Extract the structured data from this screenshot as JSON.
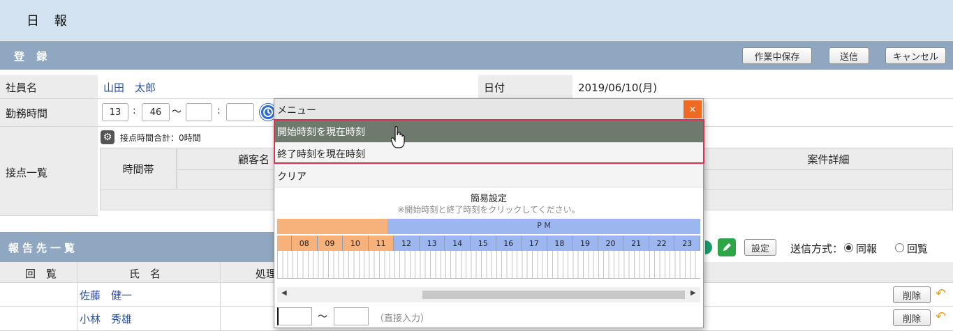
{
  "page": {
    "title": "日 報"
  },
  "register": {
    "title": "登 録",
    "buttons": {
      "save_work": "作業中保存",
      "send": "送信",
      "cancel": "キャンセル"
    },
    "employee_label": "社員名",
    "employee_name": "山田　太郎",
    "date_label": "日付",
    "date_value": "2019/06/10(月)",
    "work_time_label": "勤務時間",
    "start_hour": "13",
    "start_minute": "46",
    "colon": ":",
    "tilde": "〜",
    "contact_list_label": "接点一覧",
    "contact_total": "接点時間合計：0時間",
    "columns": {
      "time_slot": "時間帯",
      "customer_name": "顧客名",
      "case_detail": "案件詳細"
    }
  },
  "report": {
    "title": "報告先一覧",
    "settings_button": "設定",
    "send_method_label": "送信方式：",
    "send_method_options": [
      "同報",
      "回覧"
    ],
    "columns": {
      "circulation": "回　覧",
      "name": "氏　名",
      "process": "処理"
    },
    "rows": [
      {
        "name": "佐藤　健一",
        "delete": "削除"
      },
      {
        "name": "小林　秀雄",
        "delete": "削除"
      }
    ]
  },
  "popup": {
    "title": "メニュー",
    "close": "×",
    "items": [
      "開始時刻を現在時刻",
      "終了時刻を現在時刻",
      "クリア"
    ],
    "quick_title": "簡易設定",
    "quick_note": "※開始時刻と終了時刻をクリックしてください。",
    "pm_label": "P M",
    "hours": [
      "08",
      "09",
      "10",
      "11",
      "12",
      "13",
      "14",
      "15",
      "16",
      "17",
      "18",
      "19",
      "20",
      "21",
      "22",
      "23"
    ],
    "direct_input_tilde": "〜",
    "direct_input_hint": "（直接入力）"
  },
  "colors": {
    "section_bar": "#8fa7c1",
    "am_band": "#f6b27a",
    "pm_band": "#9cb7ef",
    "highlight_border": "#d9324f",
    "close_button": "#ee6a22"
  }
}
